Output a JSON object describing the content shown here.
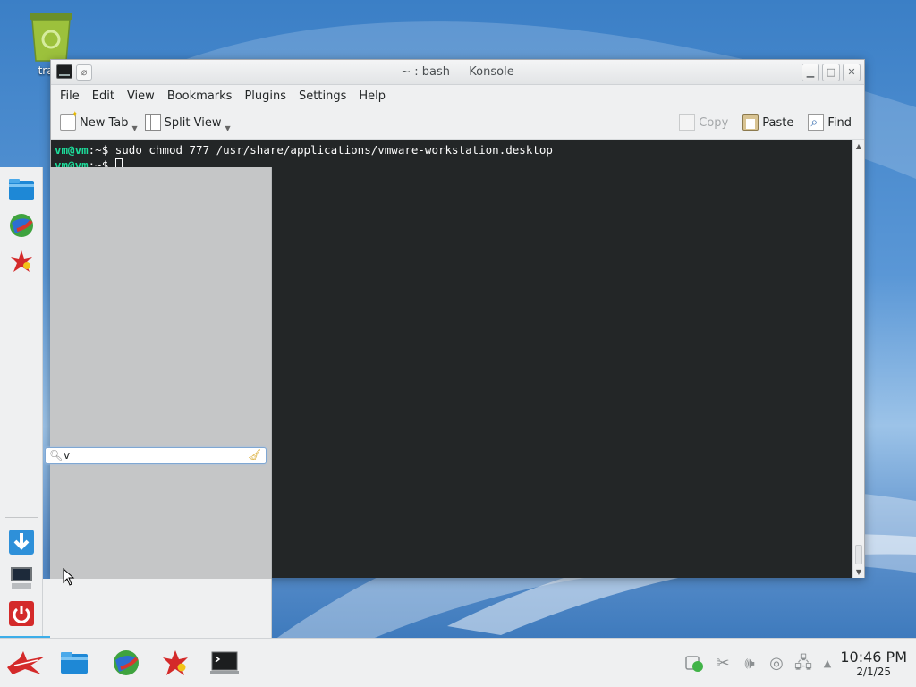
{
  "desktop": {
    "trash_label": "trash"
  },
  "konsole": {
    "title": "~ : bash — Konsole",
    "menu": [
      "File",
      "Edit",
      "View",
      "Bookmarks",
      "Plugins",
      "Settings",
      "Help"
    ],
    "toolbar": {
      "new_tab": "New Tab",
      "split_view": "Split View",
      "copy": "Copy",
      "paste": "Paste",
      "find": "Find"
    },
    "terminal": {
      "line1_prompt": "vm@vm",
      "line1_path": ":~$ ",
      "line1_cmd": "sudo chmod 777 /usr/share/applications/vmware-workstation.desktop",
      "line2_prompt": "vm@vm",
      "line2_path": ":~$ "
    }
  },
  "launcher": {
    "favorites": [
      "file-manager-icon",
      "web-browser-icon",
      "app-launcher-icon"
    ],
    "actions": [
      "install-icon",
      "computer-icon",
      "power-icon"
    ],
    "search_value": "v"
  },
  "taskbar": {
    "time": "10:46 PM",
    "date": "2/1/25"
  },
  "colors": {
    "terminal_bg": "#232627",
    "prompt": "#1cdc9a",
    "accent": "#3daee9"
  }
}
